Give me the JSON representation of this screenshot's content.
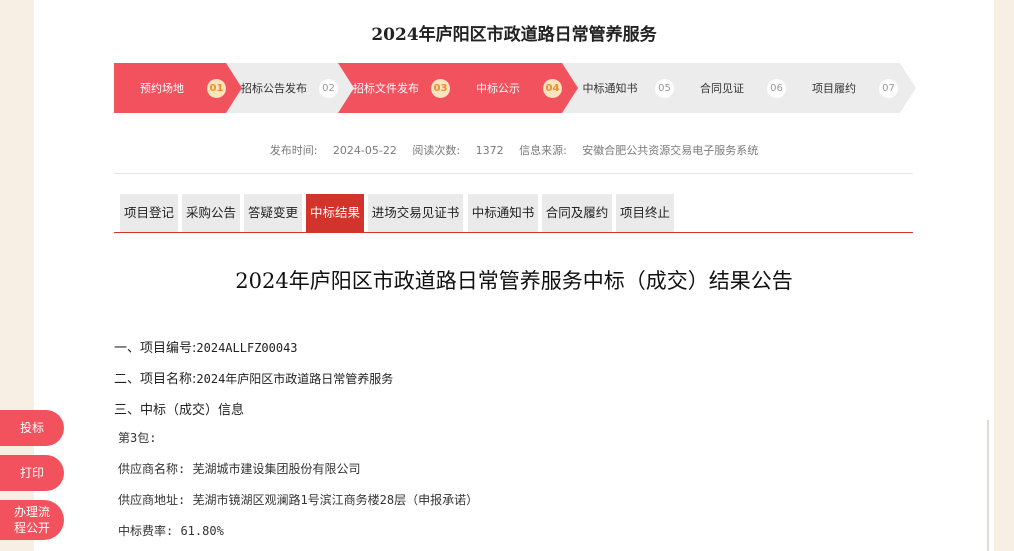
{
  "header": {
    "title": "2024年庐阳区市政道路日常管养服务"
  },
  "steps": [
    {
      "label": "预约场地",
      "num": "01"
    },
    {
      "label": "招标公告发布",
      "num": "02"
    },
    {
      "label": "招标文件发布",
      "num": "03"
    },
    {
      "label": "中标公示",
      "num": "04"
    },
    {
      "label": "中标通知书",
      "num": "05"
    },
    {
      "label": "合同见证",
      "num": "06"
    },
    {
      "label": "项目履约",
      "num": "07"
    }
  ],
  "active_steps": [
    "01",
    "03",
    "04"
  ],
  "meta": {
    "publish_label": "发布时间:",
    "publish_date": "2024-05-22",
    "views_label": "阅读次数:",
    "views": "1372",
    "source_label": "信息来源:",
    "source": "安徽合肥公共资源交易电子服务系统"
  },
  "tabs": [
    {
      "label": "项目登记"
    },
    {
      "label": "采购公告"
    },
    {
      "label": "答疑变更"
    },
    {
      "label": "中标结果"
    },
    {
      "label": "进场交易见证书"
    },
    {
      "label": "中标通知书"
    },
    {
      "label": "合同及履约"
    },
    {
      "label": "项目终止"
    }
  ],
  "active_tab": "中标结果",
  "doc": {
    "title": "2024年庐阳区市政道路日常管养服务中标（成交）结果公告",
    "item1_label": "一、项目编号:",
    "item1_value": "2024ALLFZ00043",
    "item2_label": "二、项目名称:",
    "item2_value": "2024年庐阳区市政道路日常管养服务",
    "item3_label": "三、中标（成交）信息",
    "package": "第3包:",
    "supplier_name": "供应商名称: 芜湖城市建设集团股份有限公司",
    "supplier_addr": "供应商地址: 芜湖市镜湖区观澜路1号滨江商务楼28层（申报承诺）",
    "rate": "中标费率: 61.80%"
  },
  "floating": {
    "bid": "投标",
    "print": "打印",
    "process_line1": "办理流",
    "process_line2": "程公开"
  },
  "colors": {
    "accent": "#f2525e",
    "tab_active": "#d2342c",
    "step_num_active": "#e8912c"
  }
}
